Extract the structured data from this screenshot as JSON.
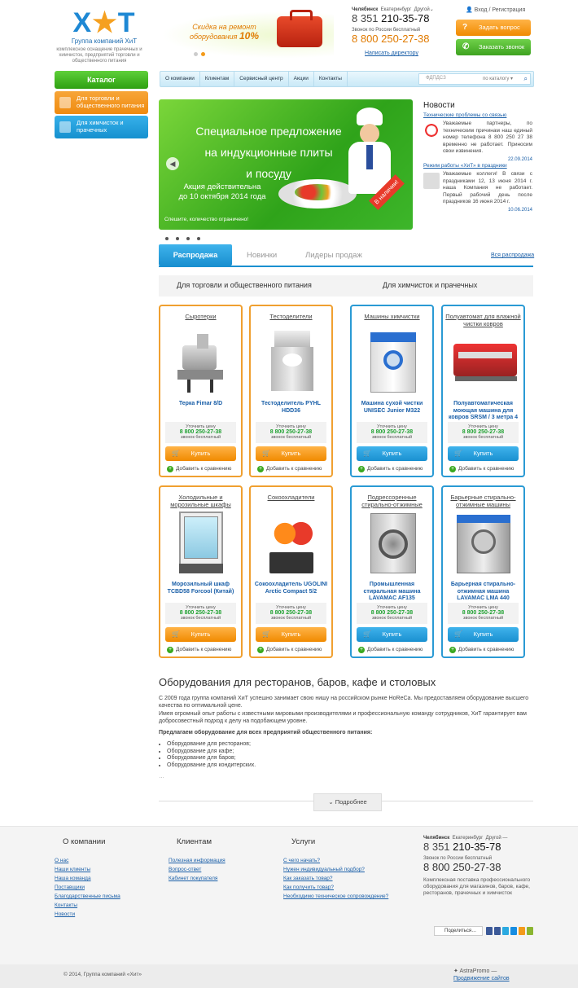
{
  "header": {
    "logo_text": "ХиТ",
    "logo_subtitle": "Группа компаний ХиТ",
    "logo_description": "комплексное оснащение прачечных и химчисток, предприятий торговли и общественного питания",
    "promo_line1": "Скидка на ремонт",
    "promo_line2": "оборудования",
    "promo_percent": "10%",
    "city_active": "Челябинск",
    "city_other": "Екатеринбург",
    "city_more": "Другой",
    "phone_code": "8 351",
    "phone_number": "210-35-78",
    "free_label": "Звонок по России бесплатный",
    "free_phone_code": "8  800",
    "free_phone_number": "250-27-38",
    "write_director": "Написать директору",
    "login": "Вход / Регистрация",
    "ask_button": "Задать вопрос",
    "call_button": "Заказать звонок"
  },
  "sidebar": {
    "catalog": "Каталог",
    "items": [
      {
        "label": "Для торговли и общественного питания",
        "color": "#ef8b10"
      },
      {
        "label": "Для химчисток и прачечных",
        "color": "#1590cf"
      }
    ]
  },
  "nav": {
    "items": [
      "О компании",
      "Клиентам",
      "Сервисный центр",
      "Акции",
      "Контакты"
    ],
    "search_placeholder": "ФДПДСЗ",
    "search_scope": "по каталогу"
  },
  "banner": {
    "line1": "Специальное предложение",
    "line2": "на индукционные плиты",
    "line3": "и посуду",
    "action1": "Акция действительна",
    "action2": "до 10 октября 2014 года",
    "hurry": "Спешите, количество ограничено!",
    "badge": "В наличии!"
  },
  "news": {
    "title": "Новости",
    "items": [
      {
        "link": "Технические проблемы со связью",
        "text": "Уважаемые партнеры, по техническим причинам наш единый номер телефона 8 800 250 27 38 временно не работает. Приносим свои извинения.",
        "date": "22.09.2014"
      },
      {
        "link": "Режим работы «ХиТ» в праздники",
        "text": "Уважаемые коллеги! В связи с праздниками 12, 13 июня 2014 г. наша Компания не работает. Первый рабочий день после праздников 16 июня 2014 г.",
        "date": "10.06.2014"
      }
    ]
  },
  "tabs": {
    "active": "Распродажа",
    "items": [
      "Новинки",
      "Лидеры продаж"
    ],
    "all_link": "Вся распродажа",
    "sub": [
      "Для торговли и общественного питания",
      "Для химчисток и прачечных"
    ]
  },
  "products": {
    "price_prefix": "Уточнить цену",
    "price_phone": "8 800 250-27-38",
    "price_suffix": "звонок бесплатный",
    "buy_label": "Купить",
    "compare_label": "Добавить к сравнению",
    "items": [
      {
        "category": "Сыротерки",
        "name": "Терка Fimar 8/D"
      },
      {
        "category": "Тестоделители",
        "name": "Тестоделитель PYHL HDD36"
      },
      {
        "category": "Машины химчистки",
        "name": "Машина сухой чистки UNISEC Junior M322"
      },
      {
        "category": "Полуавтомат для влажной чистки ковров",
        "name": "Полуавтоматическая моющая машина для ковров SRSM / 3 метра 4"
      },
      {
        "category": "Холодильные и морозильные шкафы",
        "name": "Морозильный шкаф TCBD58 Forcool (Китай)"
      },
      {
        "category": "Сокоохладители",
        "name": "Сокоохладитель UGOLINI Arctic Compact 5/2"
      },
      {
        "category": "Подрессоренные стирально-отжимные",
        "name": "Промышленная стиральная машина LAVAMAC AF135"
      },
      {
        "category": "Барьерные стирально-отжимные машины",
        "name": "Барьерная стирально-отжимная машина LAVAMAC LMA 440"
      }
    ]
  },
  "seo": {
    "title": "Оборудования для ресторанов, баров, кафе и столовых",
    "p1": "С 2009 года группа компаний ХиТ успешно занимает свою нишу на российском рынке HoReCa. Мы предоставляем оборудование высшего качества по оптимальной цене.",
    "p2": "Имея огромный опыт работы с известными мировыми производителями и профессиональную команду сотрудников, ХиТ гарантирует вам добросовестный подход к делу на подобающем уровне.",
    "p3": "Предлагаем оборудование для всех предприятий общественного питания:",
    "list": [
      "Оборудование для ресторанов;",
      "Оборудование для кафе;",
      "Оборудование для баров;",
      "Оборудование для кондитерских."
    ],
    "ellipsis": "…",
    "more": "Подробнее"
  },
  "footer": {
    "col1_title": "О компании",
    "col1": [
      "О нас",
      "Наши клиенты",
      "Наша команда",
      "Поставщики",
      "Благодарственные письма",
      "Контакты",
      "Новости"
    ],
    "col2_title": "Клиентам",
    "col2": [
      "Полезная информация",
      "Вопрос-ответ",
      "Кабинет покупателя"
    ],
    "col3_title": "Услуги",
    "col3": [
      "С чего начать?",
      "Нужен индивидуальный подбор?",
      "Как заказать товар?",
      "Как получить товар?",
      "Необходимо техническое сопровождение?"
    ],
    "description": "Комплексная поставка профессионального оборудования для магазинов, баров, кафе, ресторанов, прачечных и химчисток",
    "share": "Поделиться…",
    "copyright": "© 2014, Группа компаний «Хит»",
    "astra": "AstraPromo —",
    "astra_link": "Продвижение сайтов"
  }
}
